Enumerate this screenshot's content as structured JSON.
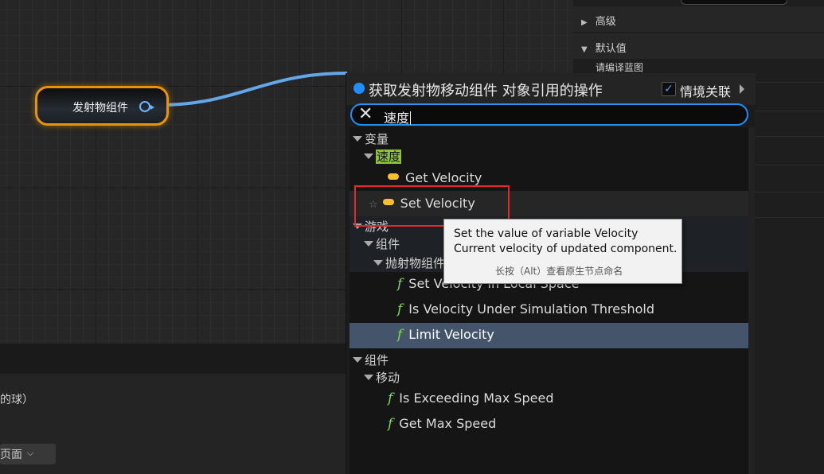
{
  "graph": {
    "node_label": "发射物组件"
  },
  "bottom_panel": {
    "partial_text": "的球）",
    "page_button_label": "页面"
  },
  "details_panel": {
    "advanced_label": "高级",
    "defaults_label": "默认值",
    "compile_blueprint_label": "请编译蓝图"
  },
  "action_menu": {
    "title": "获取发射物移动组件 对象引用的操作",
    "context_sensitive_label": "情境关联",
    "context_sensitive_checked": true,
    "search": {
      "value": "速度"
    },
    "items": [
      {
        "kind": "category",
        "label": "变量"
      },
      {
        "kind": "category",
        "label": "速度"
      },
      {
        "kind": "variable",
        "label": "Get Velocity"
      },
      {
        "kind": "variable",
        "label": "Set Velocity"
      },
      {
        "kind": "category",
        "label": "游戏"
      },
      {
        "kind": "category",
        "label": "组件"
      },
      {
        "kind": "category",
        "label": "抛射物组件"
      },
      {
        "kind": "function",
        "label": "Set Velocity in Local Space"
      },
      {
        "kind": "function",
        "label": "Is Velocity Under Simulation Threshold"
      },
      {
        "kind": "function",
        "label": "Limit Velocity"
      },
      {
        "kind": "category",
        "label": "组件"
      },
      {
        "kind": "category",
        "label": "移动"
      },
      {
        "kind": "function",
        "label": "Is Exceeding Max Speed"
      },
      {
        "kind": "function",
        "label": "Get Max Speed"
      }
    ],
    "selected_item": "Limit Velocity"
  },
  "tooltip": {
    "line1": "Set the value of variable Velocity",
    "line2": "Current velocity of updated component.",
    "hint": "长按（Alt）查看原生节点命名"
  },
  "colors": {
    "accent": "#1e8fff",
    "node_border": "#e8930b",
    "highlight_annotation": "#e02b2b",
    "selection": "#44546a",
    "search_highlight": "#8fc33a"
  }
}
